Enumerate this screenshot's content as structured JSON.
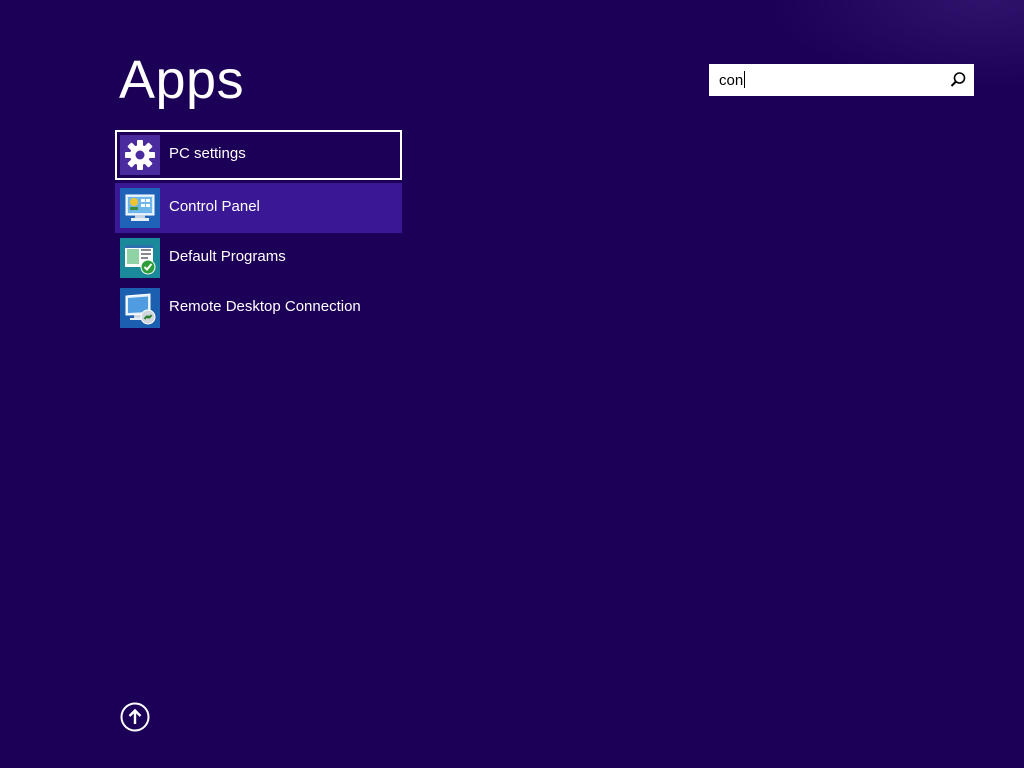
{
  "page": {
    "title": "Apps",
    "background_color": "#1c0058"
  },
  "search": {
    "value": "con",
    "icon": "search-icon"
  },
  "apps": [
    {
      "label": "PC settings",
      "icon": "gear-icon",
      "state": "selected",
      "icon_bg": "#4a2c9e"
    },
    {
      "label": "Control Panel",
      "icon": "control-panel-icon",
      "state": "hover",
      "icon_bg": "#1e63b8"
    },
    {
      "label": "Default Programs",
      "icon": "default-programs-icon",
      "state": "normal",
      "icon_bg": "#1a8a9a"
    },
    {
      "label": "Remote Desktop Connection",
      "icon": "remote-desktop-icon",
      "state": "normal",
      "icon_bg": "#1a5fb0"
    }
  ],
  "footer": {
    "up_icon": "arrow-up-circle-icon"
  }
}
